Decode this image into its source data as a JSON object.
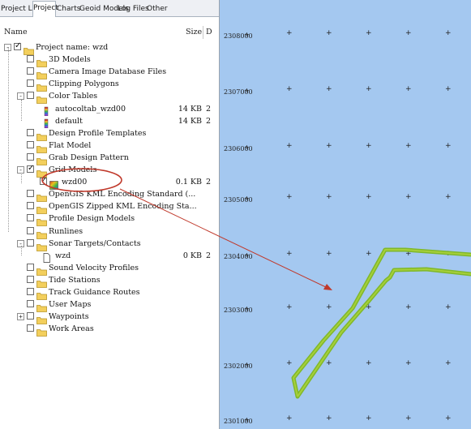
{
  "tabs": [
    {
      "label": "Project List",
      "active": false
    },
    {
      "label": "Project",
      "active": true
    },
    {
      "label": "Charts",
      "active": false
    },
    {
      "label": "Geoid Models",
      "active": false
    },
    {
      "label": "Log Files",
      "active": false
    },
    {
      "label": "Other",
      "active": false
    }
  ],
  "columns": {
    "name": "Name",
    "size": "Size",
    "date": "D"
  },
  "tree": [
    {
      "label": "Project name: wzd",
      "level": 0,
      "icon": "folder-icon",
      "expander": "-",
      "checked": true,
      "size": "",
      "date": ""
    },
    {
      "label": "3D Models",
      "level": 1,
      "icon": "folder-icon",
      "expander": "",
      "checked": false,
      "size": "",
      "date": ""
    },
    {
      "label": "Camera Image Database Files",
      "level": 1,
      "icon": "folder-icon",
      "expander": "",
      "checked": false,
      "size": "",
      "date": ""
    },
    {
      "label": "Clipping Polygons",
      "level": 1,
      "icon": "folder-icon",
      "expander": "",
      "checked": false,
      "size": "",
      "date": ""
    },
    {
      "label": "Color Tables",
      "level": 1,
      "icon": "folder-icon",
      "expander": "-",
      "checked": false,
      "size": "",
      "date": ""
    },
    {
      "label": "autocoltab_wzd00",
      "level": 2,
      "icon": "color-table-icon",
      "expander": "",
      "checked": null,
      "size": "14 KB",
      "date": "2"
    },
    {
      "label": "default",
      "level": 2,
      "icon": "color-table-icon",
      "expander": "",
      "checked": null,
      "size": "14 KB",
      "date": "2"
    },
    {
      "label": "Design Profile Templates",
      "level": 1,
      "icon": "folder-icon",
      "expander": "",
      "checked": false,
      "size": "",
      "date": ""
    },
    {
      "label": "Flat Model",
      "level": 1,
      "icon": "folder-icon",
      "expander": "",
      "checked": false,
      "size": "",
      "date": ""
    },
    {
      "label": "Grab Design Pattern",
      "level": 1,
      "icon": "folder-icon",
      "expander": "",
      "checked": false,
      "size": "",
      "date": ""
    },
    {
      "label": "Grid Models",
      "level": 1,
      "icon": "folder-icon",
      "expander": "-",
      "checked": true,
      "size": "",
      "date": ""
    },
    {
      "label": "wzd00",
      "level": 2,
      "icon": "grid-model-icon",
      "expander": "",
      "checked": true,
      "size": "0.1 KB",
      "date": "2"
    },
    {
      "label": "OpenGIS KML Encoding Standard (...",
      "level": 1,
      "icon": "folder-icon",
      "expander": "",
      "checked": false,
      "size": "",
      "date": ""
    },
    {
      "label": "OpenGIS Zipped KML Encoding Sta...",
      "level": 1,
      "icon": "folder-icon",
      "expander": "",
      "checked": false,
      "size": "",
      "date": ""
    },
    {
      "label": "Profile Design Models",
      "level": 1,
      "icon": "folder-icon",
      "expander": "",
      "checked": false,
      "size": "",
      "date": ""
    },
    {
      "label": "Runlines",
      "level": 1,
      "icon": "folder-icon",
      "expander": "",
      "checked": false,
      "size": "",
      "date": ""
    },
    {
      "label": "Sonar Targets/Contacts",
      "level": 1,
      "icon": "folder-icon",
      "expander": "-",
      "checked": false,
      "size": "",
      "date": ""
    },
    {
      "label": "wzd",
      "level": 2,
      "icon": "file-icon",
      "expander": "",
      "checked": null,
      "size": "0 KB",
      "date": "2"
    },
    {
      "label": "Sound Velocity Profiles",
      "level": 1,
      "icon": "folder-icon",
      "expander": "",
      "checked": false,
      "size": "",
      "date": ""
    },
    {
      "label": "Tide Stations",
      "level": 1,
      "icon": "folder-icon",
      "expander": "",
      "checked": false,
      "size": "",
      "date": ""
    },
    {
      "label": "Track Guidance Routes",
      "level": 1,
      "icon": "folder-icon",
      "expander": "",
      "checked": false,
      "size": "",
      "date": ""
    },
    {
      "label": "User Maps",
      "level": 1,
      "icon": "folder-icon",
      "expander": "",
      "checked": false,
      "size": "",
      "date": ""
    },
    {
      "label": "Waypoints",
      "level": 1,
      "icon": "folder-icon",
      "expander": "+",
      "checked": false,
      "size": "",
      "date": ""
    },
    {
      "label": "Work Areas",
      "level": 1,
      "icon": "folder-icon",
      "expander": "",
      "checked": false,
      "size": "",
      "date": ""
    }
  ],
  "map": {
    "background": "#a4c8f0",
    "y_labels": [
      "2308000",
      "2307000",
      "2306000",
      "2305000",
      "2304000",
      "2303000",
      "2302000",
      "2301000"
    ],
    "grid_marker": "+",
    "track_color": "#7fb82a",
    "annotation_color": "#c0392b"
  },
  "colors": {
    "accent": "#c0392b",
    "folder": "#f3cf5c",
    "map_bg": "#a4c8f0"
  }
}
